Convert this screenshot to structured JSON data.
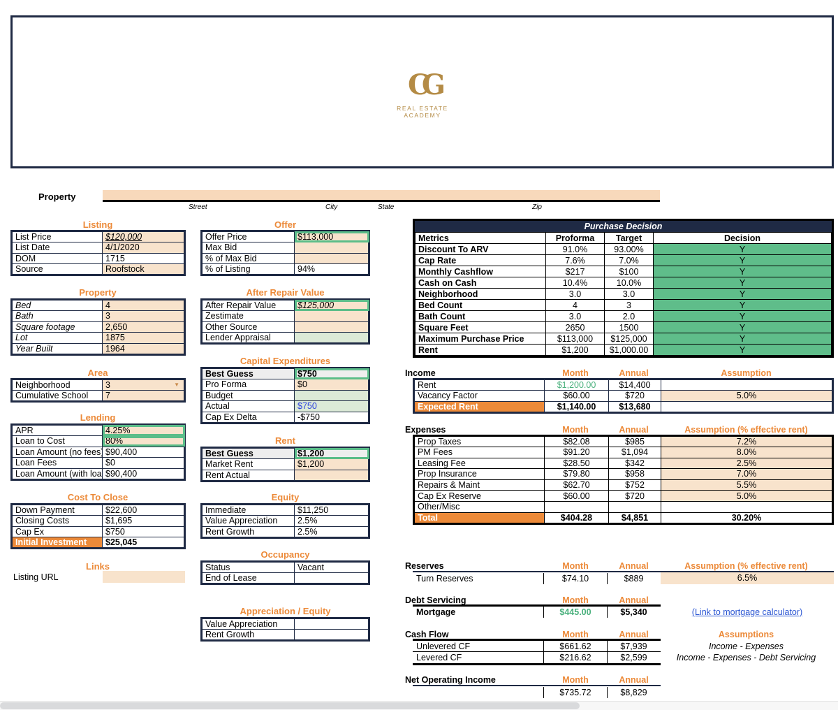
{
  "banner": {
    "logo_mark": "CG",
    "logo_text": "REAL ESTATE ACADEMY"
  },
  "property": {
    "label": "Property",
    "address_value": "",
    "captions": {
      "street": "Street",
      "city": "City",
      "state": "State",
      "zip": "Zip"
    }
  },
  "listing": {
    "title": "Listing",
    "rows": [
      {
        "label": "List Price",
        "value": "$120,000"
      },
      {
        "label": "List Date",
        "value": "4/1/2020"
      },
      {
        "label": "DOM",
        "value": "1715"
      },
      {
        "label": "Source",
        "value": "Roofstock"
      }
    ]
  },
  "offer": {
    "title": "Offer",
    "rows": [
      {
        "label": "Offer Price",
        "value": "$113,000"
      },
      {
        "label": "Max Bid",
        "value": ""
      },
      {
        "label": "% of Max Bid",
        "value": ""
      },
      {
        "label": "% of Listing",
        "value": "94%"
      }
    ]
  },
  "property_details": {
    "title": "Property",
    "rows": [
      {
        "label": "Bed",
        "value": "4"
      },
      {
        "label": "Bath",
        "value": "3"
      },
      {
        "label": "Square footage",
        "value": "2,650"
      },
      {
        "label": "Lot",
        "value": "1875"
      },
      {
        "label": "Year Built",
        "value": "1964"
      }
    ]
  },
  "arv": {
    "title": "After Repair Value",
    "rows": [
      {
        "label": "After Repair Value",
        "value": "$125,000"
      },
      {
        "label": "Zestimate",
        "value": ""
      },
      {
        "label": "Other Source",
        "value": ""
      },
      {
        "label": "Lender Appraisal",
        "value": ""
      }
    ]
  },
  "area": {
    "title": "Area",
    "rows": [
      {
        "label": "Neighborhood",
        "value": "3"
      },
      {
        "label": "Cumulative School",
        "value": "7"
      }
    ]
  },
  "capex": {
    "title": "Capital Expenditures",
    "rows": [
      {
        "label": "Best Guess",
        "value": "$750"
      },
      {
        "label": "Pro Forma",
        "value": "$0"
      },
      {
        "label": "Budget",
        "value": ""
      },
      {
        "label": "Actual",
        "value": "$750"
      },
      {
        "label": "Cap Ex Delta",
        "value": "-$750"
      }
    ]
  },
  "lending": {
    "title": "Lending",
    "rows": [
      {
        "label": "APR",
        "value": "4.25%"
      },
      {
        "label": "Loan to Cost",
        "value": "80%"
      },
      {
        "label": "Loan Amount (no fees)",
        "value": "$90,400"
      },
      {
        "label": "Loan Fees",
        "value": "$0"
      },
      {
        "label": "Loan Amount (with loan fees)",
        "value": "$90,400"
      }
    ]
  },
  "rent": {
    "title": "Rent",
    "rows": [
      {
        "label": "Best Guess",
        "value": "$1,200"
      },
      {
        "label": "Market Rent",
        "value": "$1,200"
      },
      {
        "label": "Rent Actual",
        "value": ""
      }
    ]
  },
  "cost_to_close": {
    "title": "Cost To Close",
    "rows": [
      {
        "label": "Down Payment",
        "value": "$22,600"
      },
      {
        "label": "Closing Costs",
        "value": "$1,695"
      },
      {
        "label": "Cap Ex",
        "value": "$750"
      },
      {
        "label": "Initial Investment",
        "value": "$25,045"
      }
    ]
  },
  "equity": {
    "title": "Equity",
    "rows": [
      {
        "label": "Immediate",
        "value": "$11,250"
      },
      {
        "label": "Value Appreciation",
        "value": "2.5%"
      },
      {
        "label": "Rent Growth",
        "value": "2.5%"
      }
    ]
  },
  "links": {
    "title": "Links",
    "listing_url_label": "Listing URL",
    "listing_url_value": ""
  },
  "occupancy": {
    "title": "Occupancy",
    "rows": [
      {
        "label": "Status",
        "value": "Vacant"
      },
      {
        "label": "End of Lease",
        "value": ""
      }
    ]
  },
  "appreciation_equity": {
    "title": "Appreciation / Equity",
    "rows": [
      {
        "label": "Value Appreciation",
        "value": ""
      },
      {
        "label": "Rent Growth",
        "value": ""
      }
    ]
  },
  "purchase_decision": {
    "title": "Purchase Decision",
    "headers": [
      "Metrics",
      "Proforma",
      "Target",
      "Decision"
    ],
    "rows": [
      {
        "metric": "Discount To ARV",
        "proforma": "91.0%",
        "target": "93.00%",
        "decision": "Y"
      },
      {
        "metric": "Cap Rate",
        "proforma": "7.6%",
        "target": "7.0%",
        "decision": "Y"
      },
      {
        "metric": "Monthly Cashflow",
        "proforma": "$217",
        "target": "$100",
        "decision": "Y"
      },
      {
        "metric": "Cash on Cash",
        "proforma": "10.4%",
        "target": "10.0%",
        "decision": "Y"
      },
      {
        "metric": "Neighborhood",
        "proforma": "3.0",
        "target": "3.0",
        "decision": "Y"
      },
      {
        "metric": "Bed Count",
        "proforma": "4",
        "target": "3",
        "decision": "Y"
      },
      {
        "metric": "Bath Count",
        "proforma": "3.0",
        "target": "2.0",
        "decision": "Y"
      },
      {
        "metric": "Square Feet",
        "proforma": "2650",
        "target": "1500",
        "decision": "Y"
      },
      {
        "metric": "Maximum Purchase Price",
        "proforma": "$113,000",
        "target": "$125,000",
        "decision": "Y"
      },
      {
        "metric": "Rent",
        "proforma": "$1,200",
        "target": "$1,000.00",
        "decision": "Y"
      }
    ]
  },
  "income": {
    "title": "Income",
    "col_month": "Month",
    "col_annual": "Annual",
    "col_assumption": "Assumption",
    "rows": [
      {
        "label": "Rent",
        "month": "$1,200.00",
        "annual": "$14,400",
        "assumption": ""
      },
      {
        "label": "Vacancy Factor",
        "month": "$60.00",
        "annual": "$720",
        "assumption": "5.0%"
      },
      {
        "label": "Expected Rent",
        "month": "$1,140.00",
        "annual": "$13,680",
        "assumption": ""
      }
    ]
  },
  "expenses": {
    "title": "Expenses",
    "col_month": "Month",
    "col_annual": "Annual",
    "col_assumption": "Assumption (% effective rent)",
    "rows": [
      {
        "label": "Prop Taxes",
        "month": "$82.08",
        "annual": "$985",
        "assumption": "7.2%"
      },
      {
        "label": "PM Fees",
        "month": "$91.20",
        "annual": "$1,094",
        "assumption": "8.0%"
      },
      {
        "label": "Leasing Fee",
        "month": "$28.50",
        "annual": "$342",
        "assumption": "2.5%"
      },
      {
        "label": "Prop Insurance",
        "month": "$79.80",
        "annual": "$958",
        "assumption": "7.0%"
      },
      {
        "label": "Repairs & Maint",
        "month": "$62.70",
        "annual": "$752",
        "assumption": "5.5%"
      },
      {
        "label": "Cap Ex Reserve",
        "month": "$60.00",
        "annual": "$720",
        "assumption": "5.0%"
      },
      {
        "label": "Other/Misc",
        "month": "",
        "annual": "",
        "assumption": ""
      },
      {
        "label": "Total",
        "month": "$404.28",
        "annual": "$4,851",
        "assumption": "30.20%"
      }
    ]
  },
  "reserves": {
    "title": "Reserves",
    "col_month": "Month",
    "col_annual": "Annual",
    "col_assumption": "Assumption (% effective rent)",
    "row": {
      "label": "Turn Reserves",
      "month": "$74.10",
      "annual": "$889",
      "assumption": "6.5%"
    }
  },
  "debt_servicing": {
    "title": "Debt Servicing",
    "col_month": "Month",
    "col_annual": "Annual",
    "row": {
      "label": "Mortgage",
      "month": "$445.00",
      "annual": "$5,340"
    },
    "link_label": "(Link to mortgage calculator)"
  },
  "cash_flow": {
    "title": "Cash Flow",
    "col_month": "Month",
    "col_annual": "Annual",
    "col_assumptions": "Assumptions",
    "rows": [
      {
        "label": "Unlevered CF",
        "month": "$661.62",
        "annual": "$7,939",
        "assumption": "Income - Expenses"
      },
      {
        "label": "Levered CF",
        "month": "$216.62",
        "annual": "$2,599",
        "assumption": "Income - Expenses - Debt Servicing"
      }
    ]
  },
  "noi": {
    "title": "Net Operating Income",
    "col_month": "Month",
    "col_annual": "Annual",
    "month": "$735.72",
    "annual": "$8,829"
  }
}
